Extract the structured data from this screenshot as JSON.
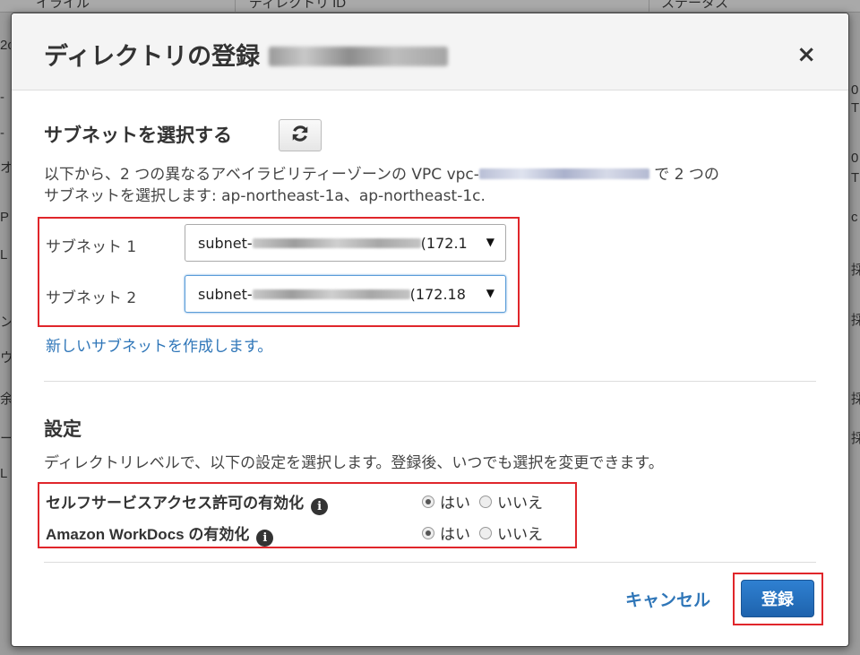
{
  "background": {
    "header_fragments": [
      "イライル",
      "ディレクトリ ID",
      "ステータス"
    ],
    "left_fragments": [
      "2c",
      "-",
      "-",
      "オ",
      "P",
      "L",
      "ン",
      "ウ",
      "余",
      "ー",
      "L"
    ],
    "right_fragments": [
      "0",
      "T",
      "0",
      "T",
      "c",
      "採",
      "採",
      "採",
      "採"
    ]
  },
  "dialog": {
    "title": "ディレクトリの登録",
    "close_label": "×",
    "subnet_section": {
      "title": "サブネットを選択する",
      "refresh_icon": "refresh-icon",
      "description_part1": "以下から、2 つの異なるアベイラビリティーゾーンの VPC vpc-",
      "description_part2": " で 2 つの",
      "description_line2": "サブネットを選択します: ap-northeast-1a、ap-northeast-1c.",
      "subnet1_label": "サブネット 1",
      "subnet1_prefix": "subnet-",
      "subnet1_suffix": " (172.1",
      "subnet2_label": "サブネット 2",
      "subnet2_prefix": "subnet-",
      "subnet2_suffix": " (172.18",
      "create_link": "新しいサブネットを作成します。"
    },
    "settings_section": {
      "title": "設定",
      "description": "ディレクトリレベルで、以下の設定を選択します。登録後、いつでも選択を変更できます。",
      "rows": [
        {
          "label": "セルフサービスアクセス許可の有効化",
          "yes": "はい",
          "no": "いいえ",
          "selected": "yes"
        },
        {
          "label": "Amazon WorkDocs の有効化",
          "yes": "はい",
          "no": "いいえ",
          "selected": "yes"
        }
      ]
    },
    "footer": {
      "cancel_label": "キャンセル",
      "register_label": "登録"
    }
  },
  "colors": {
    "highlight_border": "#e0262b",
    "link": "#2f76b8",
    "primary_button": "#1e63ad"
  }
}
